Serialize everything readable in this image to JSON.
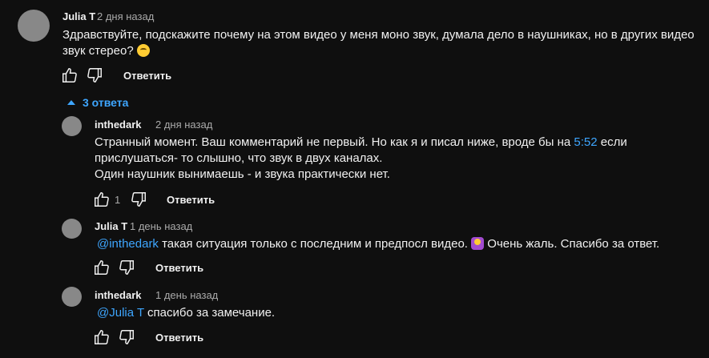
{
  "comment": {
    "author": "Julia T",
    "time": "2 дня назад",
    "text_line1": "Здравствуйте, подскажите почему  на этом видео у меня моно звук, думала дело в наушниках, но в других видео",
    "text_line2": "звук стерео?",
    "emoji": "thinking-face",
    "reply_label": "Ответить"
  },
  "replies_toggle": {
    "label": "3 ответа",
    "icon": "chevron-up-icon"
  },
  "replies": [
    {
      "author": "inthedark",
      "time": "2 дня назад",
      "line1_a": "Странный момент. Ваш комментарий не первый. Но как я и писал ниже, вроде бы на ",
      "timestamp_link": "5:52",
      "line1_b": " если",
      "line2": "прислушаться- то слышно, что звук в двух каналах.",
      "line3": "Один наушник вынимаешь - и звука практически нет.",
      "likes": "1",
      "reply_label": "Ответить"
    },
    {
      "author": "Julia T",
      "time": "1 день назад",
      "mention": "@inthedark",
      "text": " такая ситуация только с последним и предпосл видео. ",
      "emoji": "person-shrugging",
      "text_after": " Очень жаль. Спасибо за ответ.",
      "reply_label": "Ответить"
    },
    {
      "author": "inthedark",
      "time": "1 день назад",
      "mention": "@Julia T",
      "text": " спасибо за замечание.",
      "reply_label": "Ответить"
    }
  ],
  "colors": {
    "background": "#0f0f0f",
    "text": "#f1f1f1",
    "secondary": "#aaaaaa",
    "link": "#3ea6ff"
  }
}
